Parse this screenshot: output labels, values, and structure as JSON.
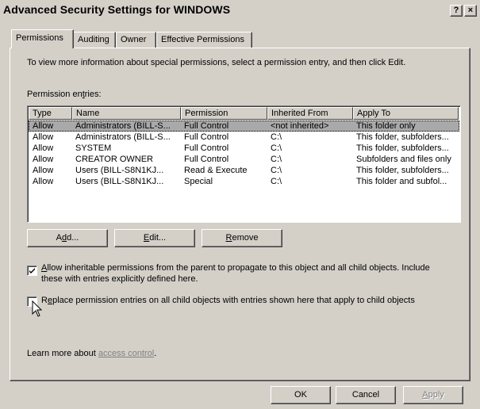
{
  "window": {
    "title": "Advanced Security Settings for WINDOWS",
    "help_button": "?",
    "close_button": "×"
  },
  "tabs": [
    {
      "label": "Permissions",
      "active": true
    },
    {
      "label": "Auditing",
      "active": false
    },
    {
      "label": "Owner",
      "active": false
    },
    {
      "label": "Effective Permissions",
      "active": false
    }
  ],
  "permissions": {
    "info_text": "To view more information about special permissions, select a permission entry, and then click Edit.",
    "entries_label_pre": "Permission en",
    "entries_label_accel": "t",
    "entries_label_post": "ries:",
    "columns": [
      "Type",
      "Name",
      "Permission",
      "Inherited From",
      "Apply To"
    ],
    "rows": [
      [
        "Allow",
        "Administrators (BILL-S...",
        "Full Control",
        "<not inherited>",
        "This folder only"
      ],
      [
        "Allow",
        "Administrators (BILL-S...",
        "Full Control",
        "C:\\",
        "This folder, subfolders..."
      ],
      [
        "Allow",
        "SYSTEM",
        "Full Control",
        "C:\\",
        "This folder, subfolders..."
      ],
      [
        "Allow",
        "CREATOR OWNER",
        "Full Control",
        "C:\\",
        "Subfolders and files only"
      ],
      [
        "Allow",
        "Users (BILL-S8N1KJ...",
        "Read & Execute",
        "C:\\",
        "This folder, subfolders..."
      ],
      [
        "Allow",
        "Users (BILL-S8N1KJ...",
        "Special",
        "C:\\",
        "This folder and subfol..."
      ]
    ],
    "selected_row": 0,
    "add_button": {
      "pre": "A",
      "accel": "d",
      "post": "d..."
    },
    "edit_button": {
      "pre": "",
      "accel": "E",
      "post": "dit..."
    },
    "remove_button": {
      "pre": "",
      "accel": "R",
      "post": "emove"
    },
    "inherit_checkbox": {
      "checked": true,
      "accel": "A",
      "line1_rest": "llow inheritable permissions from the parent to propagate to this object and all child objects. Include",
      "line2": "these with entries explicitly defined here."
    },
    "replace_checkbox": {
      "checked": false,
      "pre": "R",
      "accel": "e",
      "rest": "place permission entries on all child objects with entries shown here that apply to child objects"
    },
    "learn_more_text": "Learn more about ",
    "learn_more_link": "access control",
    "learn_more_suffix": "."
  },
  "footer": {
    "ok": "OK",
    "cancel": "Cancel",
    "apply_accel": "A",
    "apply_rest": "pply"
  }
}
